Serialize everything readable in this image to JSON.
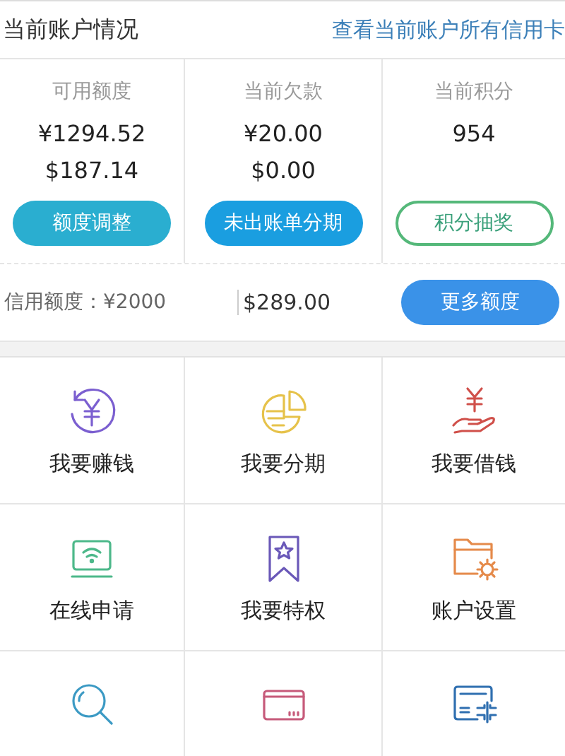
{
  "header": {
    "title": "当前账户情况",
    "link": "查看当前账户所有信用卡"
  },
  "stats": [
    {
      "label": "可用额度",
      "values": [
        "¥1294.52",
        "$187.14"
      ],
      "button": {
        "label": "额度调整",
        "kind": "teal"
      }
    },
    {
      "label": "当前欠款",
      "values": [
        "¥20.00",
        "$0.00"
      ],
      "button": {
        "label": "未出账单分期",
        "kind": "blue"
      }
    },
    {
      "label": "当前积分",
      "values": [
        "954"
      ],
      "button": {
        "label": "积分抽奖",
        "kind": "outline"
      }
    }
  ],
  "credit": {
    "label": "信用额度：¥2000",
    "usd": "$289.00",
    "button": "更多额度"
  },
  "menu": [
    {
      "label": "我要赚钱",
      "kind": "earn"
    },
    {
      "label": "我要分期",
      "kind": "installment"
    },
    {
      "label": "我要借钱",
      "kind": "borrow"
    },
    {
      "label": "在线申请",
      "kind": "apply"
    },
    {
      "label": "我要特权",
      "kind": "privilege"
    },
    {
      "label": "账户设置",
      "kind": "settings"
    },
    {
      "kind": "query"
    },
    {
      "kind": "card"
    },
    {
      "kind": "unlink"
    }
  ]
}
